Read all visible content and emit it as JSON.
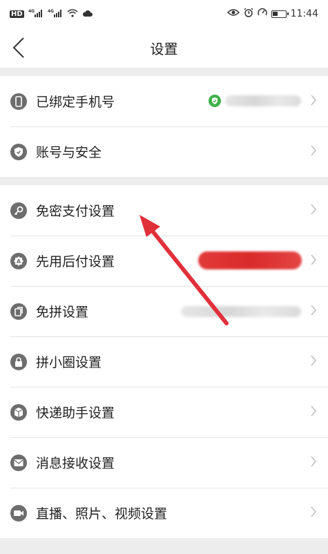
{
  "status_bar": {
    "left_label": "HD",
    "network": "4G",
    "time": "11:44"
  },
  "nav": {
    "title": "设置"
  },
  "groups": [
    {
      "items": [
        {
          "label": "已绑定手机号",
          "icon": "phone-icon",
          "value_state": "verified-blurred"
        },
        {
          "label": "账号与安全",
          "icon": "shield-icon"
        }
      ]
    },
    {
      "items": [
        {
          "label": "免密支付设置",
          "icon": "key-icon"
        },
        {
          "label": "先用后付设置",
          "icon": "badge-icon",
          "value_state": "red-highlight-blurred"
        },
        {
          "label": "免拼设置",
          "icon": "copy-icon",
          "value_state": "blurred"
        },
        {
          "label": "拼小圈设置",
          "icon": "lock-icon"
        },
        {
          "label": "快递助手设置",
          "icon": "package-icon"
        },
        {
          "label": "消息接收设置",
          "icon": "mail-icon"
        },
        {
          "label": "直播、照片、视频设置",
          "icon": "video-icon"
        }
      ]
    }
  ],
  "colors": {
    "icon_gray": "#6d6d6d",
    "verified_green": "#3fb14a",
    "annotation_red": "#e0303a",
    "background": "#ededed"
  }
}
